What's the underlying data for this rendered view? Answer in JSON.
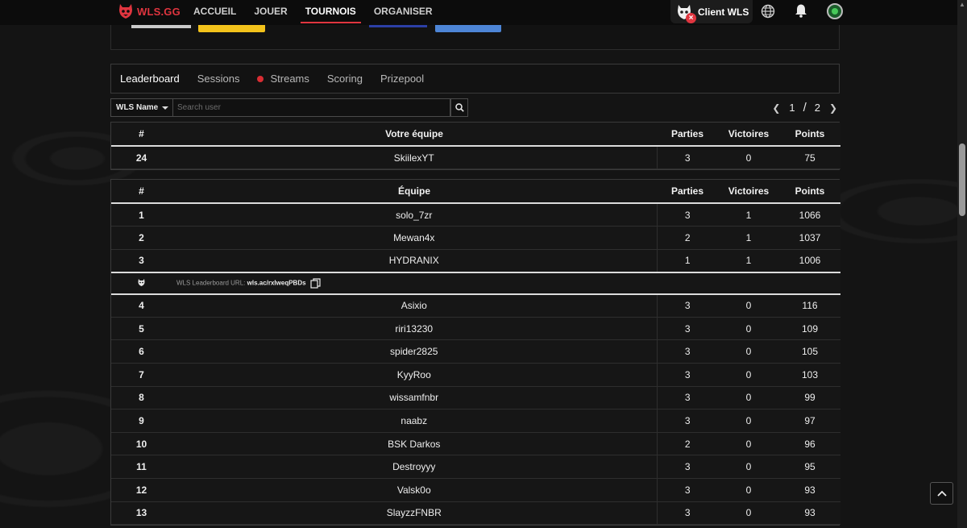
{
  "nav": {
    "brand": "WLS.GG",
    "links": [
      "ACCUEIL",
      "JOUER",
      "TOURNOIS",
      "ORGANISER"
    ],
    "active_link": "TOURNOIS",
    "client_label": "Client WLS",
    "client_status_icon": "close-icon"
  },
  "tabs": {
    "items": [
      "Leaderboard",
      "Sessions",
      "Streams",
      "Scoring",
      "Prizepool"
    ],
    "active": "Leaderboard",
    "live_color": "#d92d33"
  },
  "filter": {
    "select_label": "WLS Name",
    "search_placeholder": "Search user"
  },
  "pager": {
    "current": "1",
    "separator": "/",
    "total": "2"
  },
  "my_team": {
    "headers": {
      "rank": "#",
      "team": "Votre équipe",
      "parties": "Parties",
      "victoires": "Victoires",
      "points": "Points"
    },
    "row": {
      "rank": "24",
      "team": "SkiilexYT",
      "parties": "3",
      "victoires": "0",
      "points": "75"
    }
  },
  "leaderboard": {
    "headers": {
      "rank": "#",
      "team": "Équipe",
      "parties": "Parties",
      "victoires": "Victoires",
      "points": "Points"
    },
    "top_rows": [
      {
        "rank": "1",
        "team": "solo_7zr",
        "parties": "3",
        "victoires": "1",
        "points": "1066"
      },
      {
        "rank": "2",
        "team": "Mewan4x",
        "parties": "2",
        "victoires": "1",
        "points": "1037"
      },
      {
        "rank": "3",
        "team": "HYDRANIX",
        "parties": "1",
        "victoires": "1",
        "points": "1006"
      }
    ],
    "url_row": {
      "label": "WLS Leaderboard URL:",
      "url": "wls.ac/rxIweqPBDs"
    },
    "rows": [
      {
        "rank": "4",
        "team": "Asixio",
        "parties": "3",
        "victoires": "0",
        "points": "116"
      },
      {
        "rank": "5",
        "team": "riri13230",
        "parties": "3",
        "victoires": "0",
        "points": "109"
      },
      {
        "rank": "6",
        "team": "spider2825",
        "parties": "3",
        "victoires": "0",
        "points": "105"
      },
      {
        "rank": "7",
        "team": "KyyRoo",
        "parties": "3",
        "victoires": "0",
        "points": "103"
      },
      {
        "rank": "8",
        "team": "wissamfnbr",
        "parties": "3",
        "victoires": "0",
        "points": "99"
      },
      {
        "rank": "9",
        "team": "naabz",
        "parties": "3",
        "victoires": "0",
        "points": "97"
      },
      {
        "rank": "10",
        "team": "BSK Darkos",
        "parties": "2",
        "victoires": "0",
        "points": "96"
      },
      {
        "rank": "11",
        "team": "Destroyyy",
        "parties": "3",
        "victoires": "0",
        "points": "95"
      },
      {
        "rank": "12",
        "team": "Valsk0o",
        "parties": "3",
        "victoires": "0",
        "points": "93"
      },
      {
        "rank": "13",
        "team": "SlayzzFNBR",
        "parties": "3",
        "victoires": "0",
        "points": "93"
      }
    ]
  },
  "colors": {
    "brand_red": "#e0353f",
    "background": "#141414",
    "yellow_button": "#f3c21b",
    "blue_button": "#4d85d6"
  }
}
